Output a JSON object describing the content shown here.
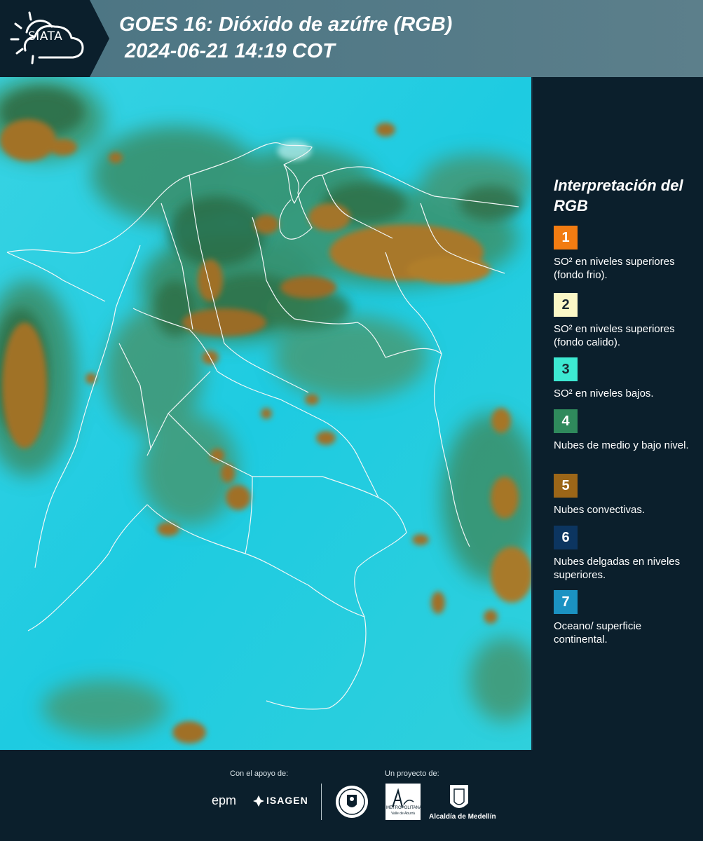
{
  "header": {
    "logo_text": "SIATA",
    "title_line1": "GOES 16: Dióxido de azúfre (RGB)",
    "title_line2": " 2024-06-21 14:19 COT"
  },
  "legend": {
    "title": "Interpretación del RGB",
    "items": [
      {
        "number": "1",
        "color": "#f27c12",
        "text": "SO² en niveles superiores (fondo frio)."
      },
      {
        "number": "2",
        "color": "#fbf7c6",
        "text": "SO² en niveles superiores (fondo calido)."
      },
      {
        "number": "3",
        "color": "#3de9d2",
        "text": "SO² en niveles bajos."
      },
      {
        "number": "4",
        "color": "#2f8a5c",
        "text": "Nubes de medio y bajo nivel."
      },
      {
        "number": "5",
        "color": "#9c6618",
        "text": "Nubes convectivas."
      },
      {
        "number": "6",
        "color": "#0c3560",
        "text": "Nubes delgadas en niveles superiores."
      },
      {
        "number": "7",
        "color": "#1b92c2",
        "text": "Oceano/ superficie continental."
      }
    ]
  },
  "footer": {
    "support_label": "Con el apoyo de:",
    "project_label": "Un proyecto de:",
    "sponsor_1": "epm",
    "sponsor_2": "ISAGEN",
    "partner_1": "Área Metropolitana",
    "partner_1_sub": "METROPOLITANA",
    "partner_1_sub2": "Valle de Aburrá",
    "partner_2": "Alcaldía de Medellín"
  },
  "colors": {
    "background": "#0b1f2c",
    "header_band": "#557b88",
    "map_base": "#22cde0",
    "cloud_green": "#2f7d4a",
    "cloud_brown": "#a5761e"
  }
}
